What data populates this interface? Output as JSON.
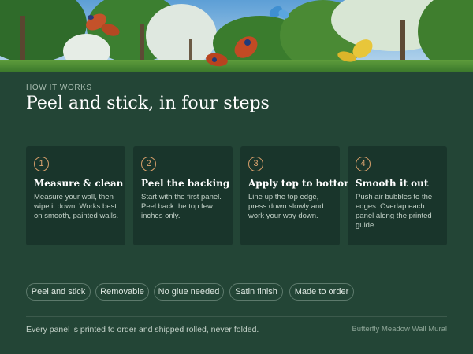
{
  "hero": {
    "butterfly_colors": [
      "#c4522a",
      "#3f8fd1",
      "#e8c63a"
    ],
    "sky_color": "#6aa6d6",
    "foliage_color": "#3f8a34"
  },
  "section": {
    "eyebrow": "HOW IT WORKS",
    "title": "Peel and stick, in four steps"
  },
  "steps": [
    {
      "number": "1",
      "title": "Measure & clean",
      "description": "Measure your wall, then wipe it down. Works best on smooth, painted walls."
    },
    {
      "number": "2",
      "title": "Peel the backing",
      "description": "Start with the first panel. Peel back the top few inches only."
    },
    {
      "number": "3",
      "title": "Apply top to bottom",
      "description": "Line up the top edge, press down slowly and work your way down."
    },
    {
      "number": "4",
      "title": "Smooth it out",
      "description": "Push air bubbles to the edges. Overlap each panel along the printed guide."
    }
  ],
  "features": [
    "Peel and stick",
    "Removable",
    "No glue needed",
    "Satin finish",
    "Made to order"
  ],
  "footer": {
    "note": "Every panel is printed to order and shipped rolled, never folded.",
    "product": "Butterfly Meadow Wall Mural"
  },
  "colors": {
    "background": "#234536",
    "card": "#19352b",
    "accent": "#e0a772"
  }
}
